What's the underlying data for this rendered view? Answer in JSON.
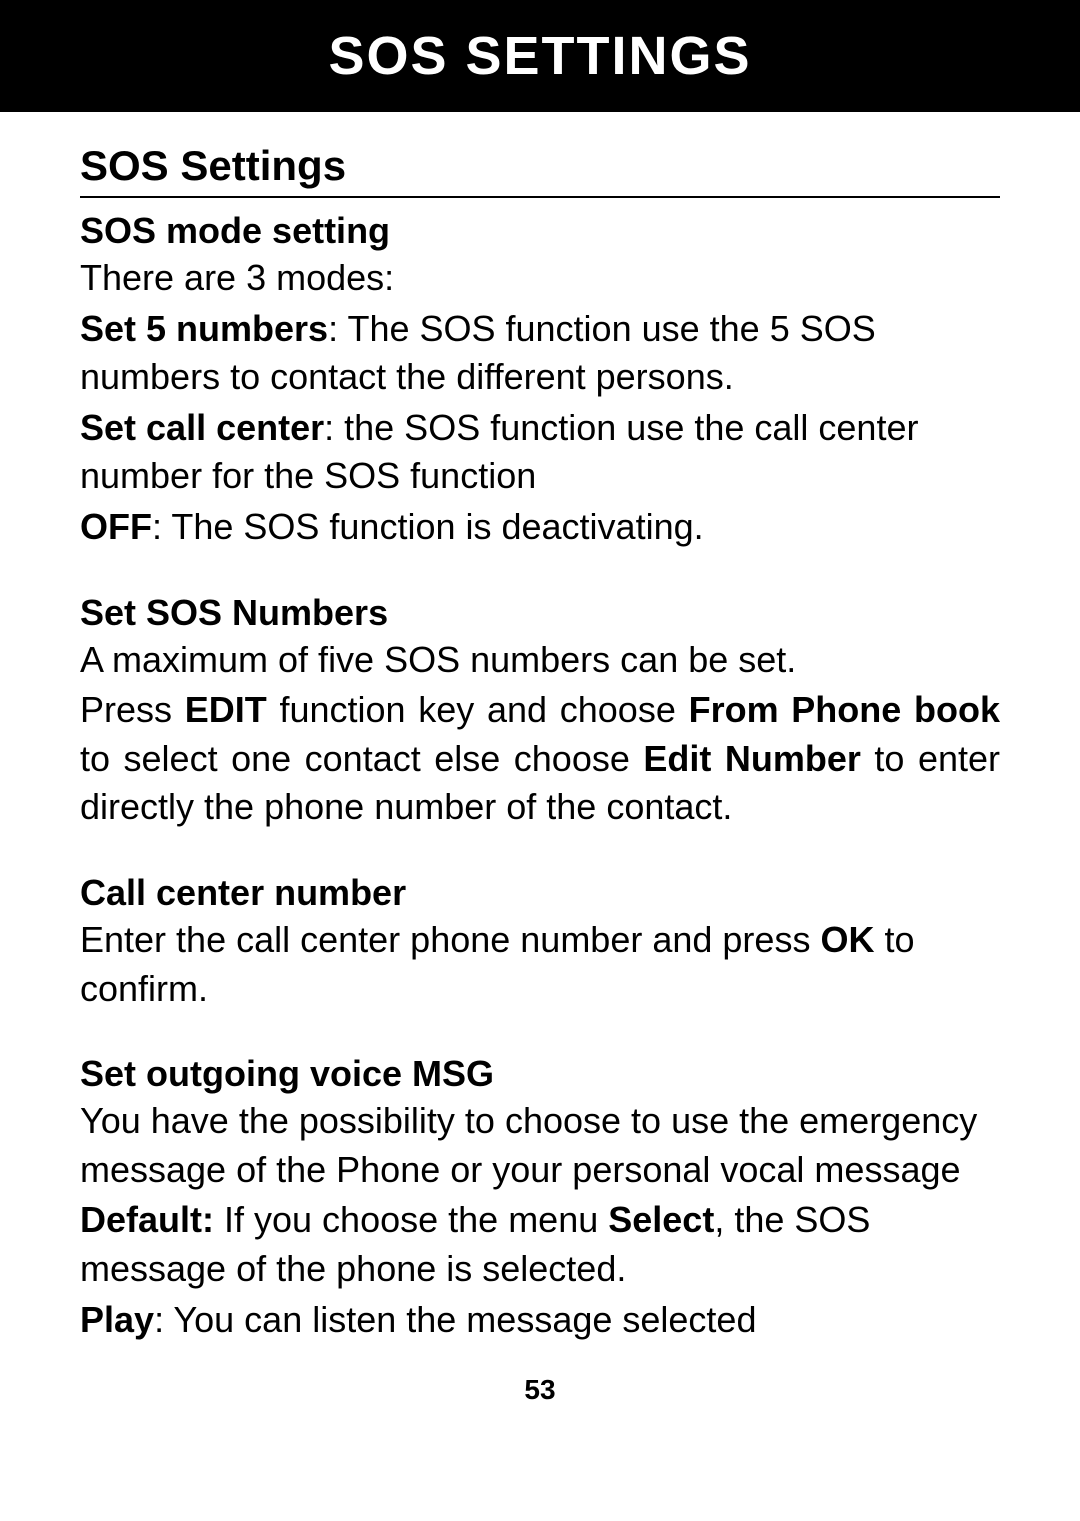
{
  "header": {
    "title": "SOS SETTINGS"
  },
  "section_title": "SOS Settings",
  "sos_mode": {
    "heading": "SOS mode setting",
    "intro": "There are 3 modes:",
    "set5_label": "Set 5 numbers",
    "set5_rest": ": The SOS function use the 5 SOS numbers to contact the different persons.",
    "callcenter_label": "Set call center",
    "callcenter_rest": ": the SOS function use the call center number for the SOS function",
    "off_label": "OFF",
    "off_rest": ": The SOS function is deactivating."
  },
  "set_sos_numbers": {
    "heading": "Set SOS Numbers",
    "line1": "A maximum of five SOS numbers can be set.",
    "p2a": "Press ",
    "p2b": "EDIT",
    "p2c": " function key and choose ",
    "p2d": "From Phone book",
    "p2e": " to select one contact else choose ",
    "p2f": "Edit Number",
    "p2g": " to enter directly the phone number of the contact."
  },
  "call_center": {
    "heading": "Call center number",
    "p1a": "Enter the call center phone number and press ",
    "p1b": "OK",
    "p1c": " to confirm."
  },
  "outgoing_msg": {
    "heading": "Set outgoing voice MSG",
    "p1": "You have the possibility to choose to use the emergency message of the Phone or your personal vocal message",
    "default_label": "Default:",
    "default_a": " If you choose the menu ",
    "default_b": "Select",
    "default_c": ", the SOS message of the phone is selected.",
    "play_label": "Play",
    "play_rest": ": You can listen the message selected"
  },
  "page_number": "53"
}
